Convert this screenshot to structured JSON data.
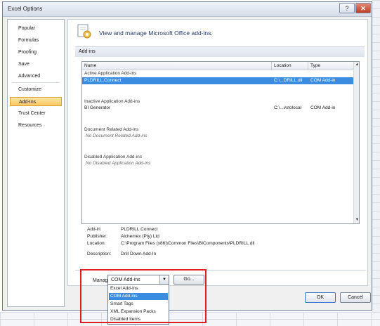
{
  "window": {
    "title": "Excel Options",
    "help_glyph": "?",
    "close_glyph": "✕"
  },
  "sidebar": {
    "items": [
      {
        "label": "Popular"
      },
      {
        "label": "Formulas"
      },
      {
        "label": "Proofing"
      },
      {
        "label": "Save"
      },
      {
        "label": "Advanced"
      },
      {
        "label": "Customize"
      },
      {
        "label": "Add-Ins"
      },
      {
        "label": "Trust Center"
      },
      {
        "label": "Resources"
      }
    ],
    "active": "Add-Ins"
  },
  "header": {
    "text": "View and manage Microsoft Office add-ins.",
    "icon": "addins-gear-icon"
  },
  "section": {
    "title": "Add-ins"
  },
  "table": {
    "columns": [
      "Name",
      "Location",
      "Type"
    ],
    "groups": [
      {
        "title": "Active Application Add-ins",
        "rows": [
          {
            "name": "PLDRILL.Connect",
            "location": "C:\\...DRILL.dll",
            "type": "COM Add-in",
            "selected": true
          }
        ]
      },
      {
        "title": "Inactive Application Add-ins",
        "rows": [
          {
            "name": "BI Generator",
            "location": "C:\\...vstolocal",
            "type": "COM Add-in"
          }
        ]
      },
      {
        "title": "Document Related Add-ins",
        "empty": "No Document Related Add-ins"
      },
      {
        "title": "Disabled Application Add-ins",
        "empty": "No Disabled Application Add-ins"
      }
    ]
  },
  "details": {
    "addin_label": "Add-in:",
    "addin_value": "PLDRILL.Connect",
    "publisher_label": "Publisher:",
    "publisher_value": "Alchemex (Pty) Ltd",
    "location_label": "Location:",
    "location_value": "C:\\Program Files (x86)\\Common Files\\BIComponents\\PLDRILL.dll",
    "description_label": "Description:",
    "description_value": "Drill Down Add-In"
  },
  "manage": {
    "label": "Manage:",
    "selected": "COM Add-ins",
    "go_label": "Go...",
    "options": [
      "Excel Add-ins",
      "COM Add-ins",
      "Smart Tags",
      "XML Expansion Packs",
      "Disabled Items"
    ],
    "highlight_color": "#e02020"
  },
  "buttons": {
    "ok": "OK",
    "cancel": "Cancel"
  }
}
